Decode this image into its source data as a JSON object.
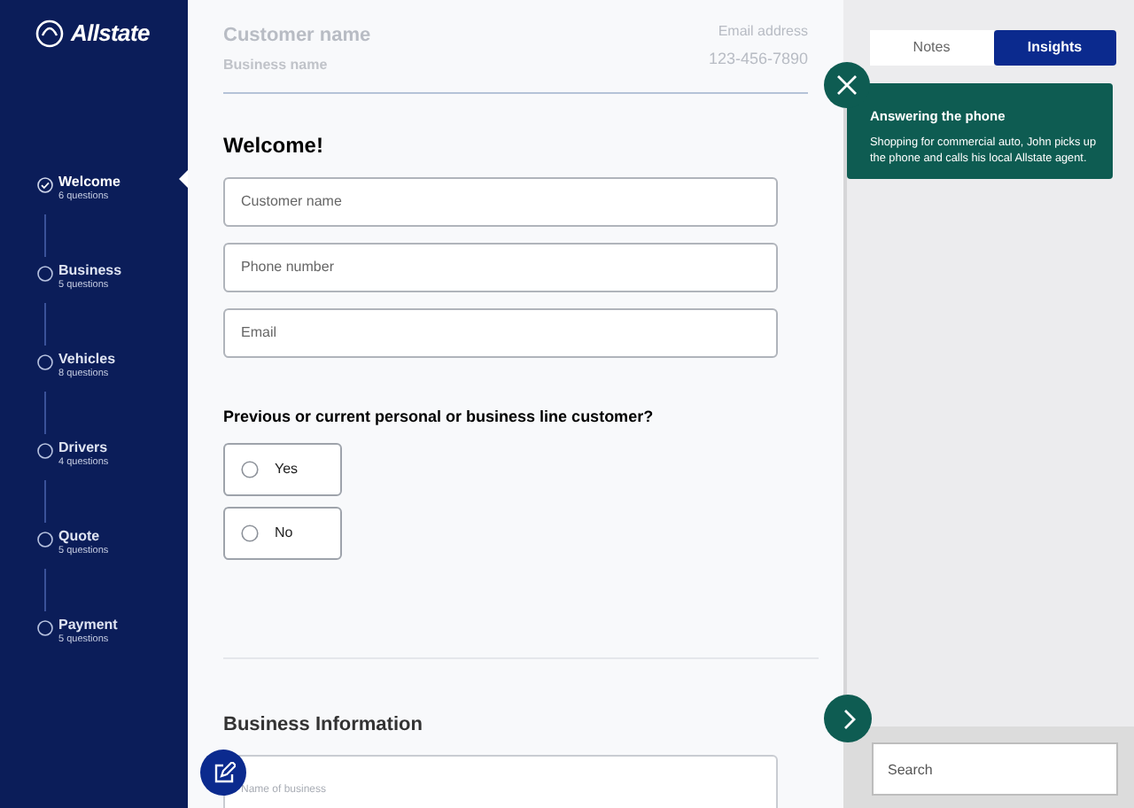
{
  "brand": "Allstate",
  "steps": [
    {
      "label": "Welcome",
      "sub": "6 questions",
      "selected": true
    },
    {
      "label": "Business",
      "sub": "5 questions",
      "selected": false
    },
    {
      "label": "Vehicles",
      "sub": "8 questions",
      "selected": false
    },
    {
      "label": "Drivers",
      "sub": "4 questions",
      "selected": false
    },
    {
      "label": "Quote",
      "sub": "5 questions",
      "selected": false
    },
    {
      "label": "Payment",
      "sub": "5 questions",
      "selected": false
    }
  ],
  "header": {
    "customer_name": "Customer name",
    "business_name": "Business name",
    "email": "Email address",
    "phone": "123-456-7890"
  },
  "welcome": {
    "title": "Welcome!",
    "fields": [
      {
        "placeholder": "Customer name"
      },
      {
        "placeholder": "Phone number"
      },
      {
        "placeholder": "Email"
      }
    ],
    "question": "Previous or current personal or business line customer?",
    "options": [
      {
        "label": "Yes",
        "selected": false
      },
      {
        "label": "No",
        "selected": false
      }
    ]
  },
  "business": {
    "title": "Business Information",
    "field_label": "Name of business"
  },
  "tabs": [
    {
      "label": "Notes",
      "selected": false
    },
    {
      "label": "Insights",
      "selected": true
    }
  ],
  "insight": {
    "title": "Answering the phone",
    "text": "Shopping for commercial auto, John picks up the phone and calls his local Allstate agent."
  },
  "search": {
    "placeholder": "Search"
  }
}
